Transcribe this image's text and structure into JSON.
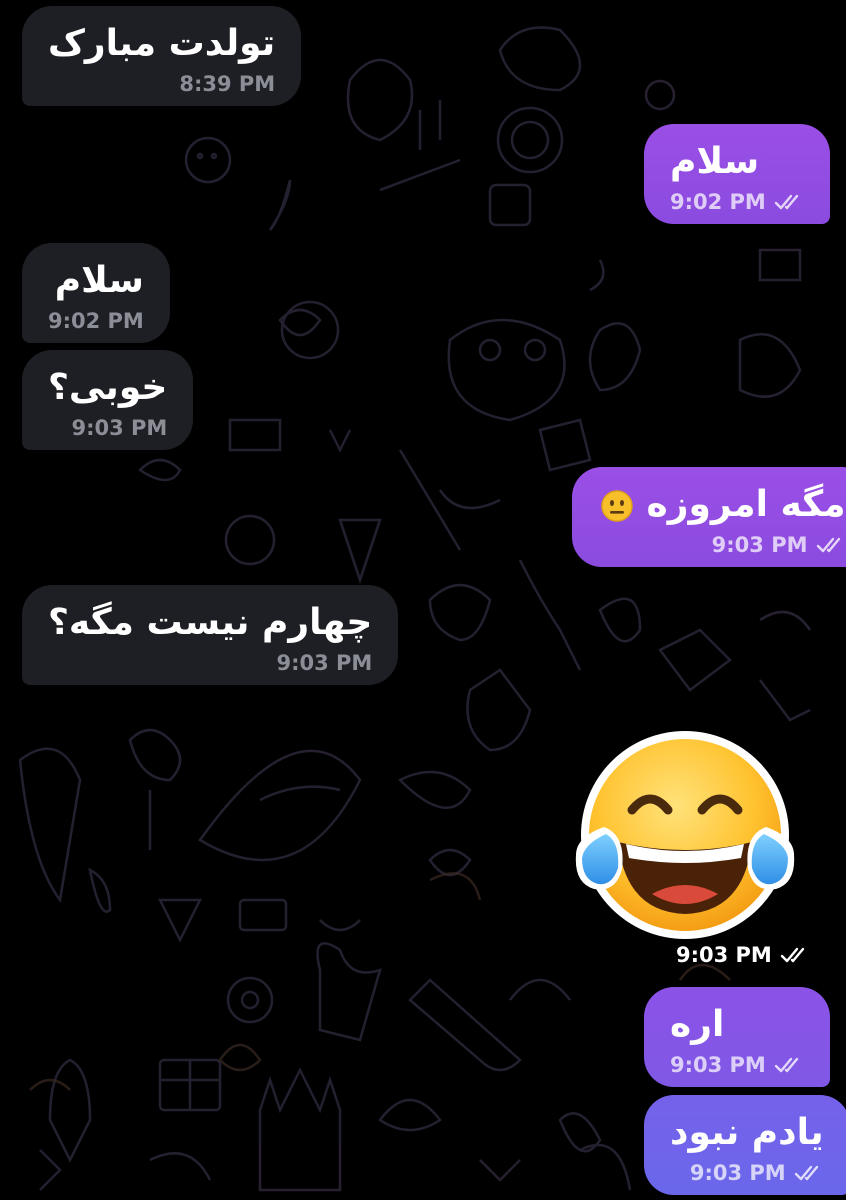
{
  "chat": {
    "messages": [
      {
        "side": "incoming",
        "text": "تولدت مبارک",
        "time": "8:39 PM"
      },
      {
        "side": "outgoing",
        "text": "سلام",
        "time": "9:02 PM",
        "status_icon": "double-check-icon"
      },
      {
        "side": "incoming",
        "text": "سلام",
        "time": "9:02 PM"
      },
      {
        "side": "incoming",
        "text": "خوبی؟",
        "time": "9:03 PM"
      },
      {
        "side": "outgoing",
        "text": "مگه امروزه",
        "emoji": "neutral-face-emoji",
        "time": "9:03 PM",
        "status_icon": "double-check-icon"
      },
      {
        "side": "incoming",
        "text": "چهارم نیست مگه؟",
        "time": "9:03 PM"
      },
      {
        "side": "outgoing",
        "sticker": "face-with-tears-of-joy-sticker",
        "time": "9:03 PM",
        "status_icon": "double-check-icon"
      },
      {
        "side": "outgoing",
        "text": "اره",
        "time": "9:03 PM",
        "status_icon": "double-check-icon"
      },
      {
        "side": "outgoing",
        "text": "یادم نبود",
        "time": "9:03 PM",
        "status_icon": "double-check-icon"
      }
    ]
  },
  "colors": {
    "background": "#000000",
    "incoming_bubble": "#1e1f24",
    "outgoing_bubble_top": "#9a4fe6",
    "outgoing_bubble_bottom": "#6a67ea",
    "incoming_time": "#8b8e97"
  }
}
